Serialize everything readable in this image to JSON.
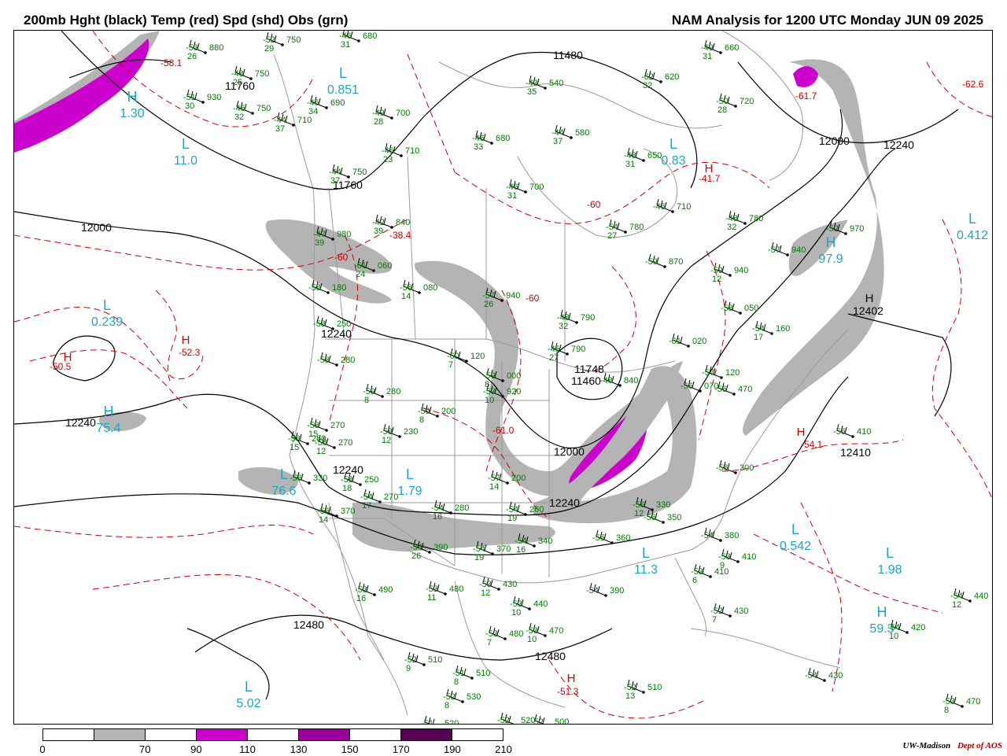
{
  "header": {
    "left_title": "200mb Hght (black) Temp (red) Spd (shd) Obs (grn)",
    "right_title": "NAM Analysis for 1200 UTC Monday  JUN 09 2025"
  },
  "colors": {
    "height_contour": "#000000",
    "temperature_contour": "#cc0000",
    "observation_text": "#007a00",
    "center_label": "#1aa6c6",
    "speed_70_90": "#b4b4b4",
    "speed_110_130": "#cc00cc",
    "speed_150_170": "#990099",
    "speed_190_210": "#550055",
    "geography": "#9a9a9a"
  },
  "height_labels": [
    "11760",
    "11480",
    "12000",
    "12240",
    "12402",
    "12410",
    "11760",
    "12240",
    "12000",
    "12240",
    "11748",
    "11460",
    "12000",
    "12240",
    "12240",
    "12480",
    "12480"
  ],
  "temperature_labels": [
    "-58.1",
    "-61.7",
    "-62.6",
    "-41.7",
    "-60",
    "-38.4",
    "-60",
    "-52.3",
    "-50.5",
    "-60",
    "-61.0",
    "-54.1",
    "-51.3"
  ],
  "centers": [
    {
      "letter": "L",
      "value": "0.851"
    },
    {
      "letter": "H",
      "value": "1.30"
    },
    {
      "letter": "L",
      "value": "11.0"
    },
    {
      "letter": "L",
      "value": "0.83"
    },
    {
      "letter": "L",
      "value": "0.412"
    },
    {
      "letter": "H",
      "value": "97.9"
    },
    {
      "letter": "L",
      "value": "0.239"
    },
    {
      "letter": "H",
      "value": "75.4"
    },
    {
      "letter": "L",
      "value": "1.79"
    },
    {
      "letter": "L",
      "value": "0.542"
    },
    {
      "letter": "L",
      "value": "1.98"
    },
    {
      "letter": "L",
      "value": "11.3"
    },
    {
      "letter": "H",
      "value": "59.3"
    },
    {
      "letter": "L",
      "value": "5.02"
    },
    {
      "letter": "L",
      "value": "76.6"
    }
  ],
  "pressure_centers": [
    {
      "letter": "H",
      "value": ""
    },
    {
      "letter": "H",
      "value": ""
    },
    {
      "letter": "H",
      "value": ""
    },
    {
      "letter": "H",
      "value": ""
    },
    {
      "letter": "H",
      "value": ""
    },
    {
      "letter": "H",
      "value": ""
    }
  ],
  "observations": [
    {
      "temp": "-53",
      "height": "880",
      "dew": "26"
    },
    {
      "temp": "-52",
      "height": "750",
      "dew": "29"
    },
    {
      "temp": "-46",
      "height": "680",
      "dew": "31"
    },
    {
      "temp": "-49",
      "height": "660",
      "dew": "31"
    },
    {
      "temp": "-48",
      "height": "750",
      "dew": "25"
    },
    {
      "temp": "-51",
      "height": "930",
      "dew": "30"
    },
    {
      "temp": "-45",
      "height": "690",
      "dew": "34"
    },
    {
      "temp": "-43",
      "height": "540",
      "dew": "35"
    },
    {
      "temp": "-62",
      "height": "620",
      "dew": "32"
    },
    {
      "temp": "-45",
      "height": "750",
      "dew": "32"
    },
    {
      "temp": "-44",
      "height": "710",
      "dew": "37"
    },
    {
      "temp": "-49",
      "height": "700",
      "dew": "28"
    },
    {
      "temp": "-46",
      "height": "680",
      "dew": "33"
    },
    {
      "temp": "-44",
      "height": "580",
      "dew": "37"
    },
    {
      "temp": "-50",
      "height": "720",
      "dew": "28"
    },
    {
      "temp": "-45",
      "height": "710",
      "dew": "23"
    },
    {
      "temp": "-48",
      "height": "650",
      "dew": "31"
    },
    {
      "temp": "-44",
      "height": "750",
      "dew": "37"
    },
    {
      "temp": "-46",
      "height": "700",
      "dew": "31"
    },
    {
      "temp": "-46",
      "height": "710",
      "dew": ""
    },
    {
      "temp": "-42",
      "height": "840",
      "dew": "39"
    },
    {
      "temp": "-48",
      "height": "780",
      "dew": "32"
    },
    {
      "temp": "-47",
      "height": "980",
      "dew": "39"
    },
    {
      "temp": "-54",
      "height": "780",
      "dew": "27"
    },
    {
      "temp": "-52",
      "height": "970",
      "dew": ""
    },
    {
      "temp": "-57",
      "height": "940",
      "dew": ""
    },
    {
      "temp": "-59",
      "height": "870",
      "dew": ""
    },
    {
      "temp": "-61",
      "height": "060",
      "dew": "24"
    },
    {
      "temp": "-56",
      "height": "080",
      "dew": "14"
    },
    {
      "temp": "-58",
      "height": "180",
      "dew": ""
    },
    {
      "temp": "-57",
      "height": "940",
      "dew": "26"
    },
    {
      "temp": "-59",
      "height": "940",
      "dew": "12"
    },
    {
      "temp": "-48",
      "height": "790",
      "dew": "32"
    },
    {
      "temp": "-58",
      "height": "050",
      "dew": ""
    },
    {
      "temp": "-58",
      "height": "250",
      "dew": ""
    },
    {
      "temp": "-54",
      "height": "160",
      "dew": "17"
    },
    {
      "temp": "-45",
      "height": "790",
      "dew": "27"
    },
    {
      "temp": "-61",
      "height": "020",
      "dew": ""
    },
    {
      "temp": "-58",
      "height": "280",
      "dew": ""
    },
    {
      "temp": "-60",
      "height": "120",
      "dew": "7"
    },
    {
      "temp": "-59",
      "height": "000",
      "dew": "8"
    },
    {
      "temp": "-57",
      "height": "120",
      "dew": ""
    },
    {
      "temp": "-53",
      "height": "920",
      "dew": "10"
    },
    {
      "temp": "-48",
      "height": "840",
      "dew": ""
    },
    {
      "temp": "-56",
      "height": "070",
      "dew": ""
    },
    {
      "temp": "-56",
      "height": "470",
      "dew": ""
    },
    {
      "temp": "-59",
      "height": "280",
      "dew": "8"
    },
    {
      "temp": "-59",
      "height": "200",
      "dew": "8"
    },
    {
      "temp": "-58",
      "height": "270",
      "dew": "15"
    },
    {
      "temp": "-58",
      "height": "230",
      "dew": "12"
    },
    {
      "temp": "-58",
      "height": "270",
      "dew": "12"
    },
    {
      "temp": "-56",
      "height": "410",
      "dew": ""
    },
    {
      "temp": "-58",
      "height": "260",
      "dew": "15"
    },
    {
      "temp": "-56",
      "height": "330",
      "dew": ""
    },
    {
      "temp": "-58",
      "height": "250",
      "dew": "18"
    },
    {
      "temp": "-57",
      "height": "200",
      "dew": "14"
    },
    {
      "temp": "-56",
      "height": "300",
      "dew": ""
    },
    {
      "temp": "-56",
      "height": "370",
      "dew": "14"
    },
    {
      "temp": "-54",
      "height": "270",
      "dew": "17"
    },
    {
      "temp": "-54",
      "height": "260",
      "dew": "19"
    },
    {
      "temp": "-54",
      "height": "280",
      "dew": "16"
    },
    {
      "temp": "-56",
      "height": "330",
      "dew": "12"
    },
    {
      "temp": "-56",
      "height": "350",
      "dew": ""
    },
    {
      "temp": "-54",
      "height": "340",
      "dew": "16"
    },
    {
      "temp": "-54",
      "height": "380",
      "dew": ""
    },
    {
      "temp": "-54",
      "height": "390",
      "dew": "26"
    },
    {
      "temp": "-54",
      "height": "370",
      "dew": "19"
    },
    {
      "temp": "-55",
      "height": "360",
      "dew": ""
    },
    {
      "temp": "-53",
      "height": "410",
      "dew": "9"
    },
    {
      "temp": "-53",
      "height": "490",
      "dew": "16"
    },
    {
      "temp": "-53",
      "height": "480",
      "dew": "11"
    },
    {
      "temp": "-53",
      "height": "430",
      "dew": "12"
    },
    {
      "temp": "-53",
      "height": "440",
      "dew": "10"
    },
    {
      "temp": "-53",
      "height": "480",
      "dew": "7"
    },
    {
      "temp": "-53",
      "height": "470",
      "dew": "10"
    },
    {
      "temp": "-54",
      "height": "390",
      "dew": ""
    },
    {
      "temp": "-52",
      "height": "430",
      "dew": "7"
    },
    {
      "temp": "-53",
      "height": "410",
      "dew": "6"
    },
    {
      "temp": "-54",
      "height": "440",
      "dew": "12"
    },
    {
      "temp": "-54",
      "height": "420",
      "dew": "10"
    },
    {
      "temp": "-52",
      "height": "510",
      "dew": "9"
    },
    {
      "temp": "-51",
      "height": "510",
      "dew": "8"
    },
    {
      "temp": "-52",
      "height": "530",
      "dew": "8"
    },
    {
      "temp": "-52",
      "height": "510",
      "dew": "13"
    },
    {
      "temp": "-54",
      "height": "430",
      "dew": ""
    },
    {
      "temp": "-53",
      "height": "470",
      "dew": "8"
    },
    {
      "temp": "-52",
      "height": "520",
      "dew": ""
    },
    {
      "temp": "-52",
      "height": "500",
      "dew": ""
    },
    {
      "temp": "-51",
      "height": "520",
      "dew": ""
    }
  ],
  "legend": {
    "ticks": [
      "0",
      "70",
      "90",
      "110",
      "130",
      "150",
      "170",
      "190",
      "210"
    ],
    "fills": [
      "#ffffff",
      "#b4b4b4",
      "#ffffff",
      "#cc00cc",
      "#ffffff",
      "#990099",
      "#ffffff",
      "#550055",
      "#ffffff"
    ]
  },
  "credit": {
    "org": "UW-Madison",
    "dept": "Dept of AOS"
  }
}
